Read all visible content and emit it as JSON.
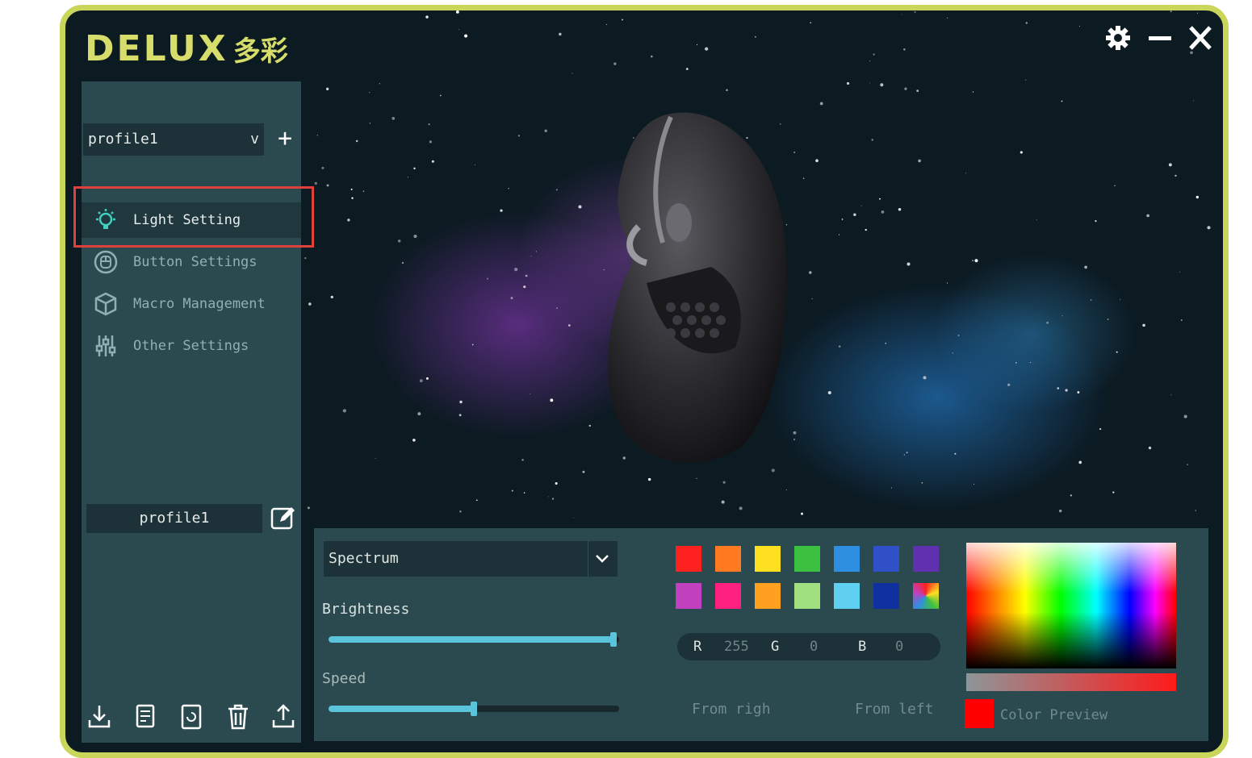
{
  "app": {
    "brand": "DELUX",
    "brand_cjk": "多彩",
    "window_controls": [
      "gear-icon",
      "minimize-icon",
      "close-icon"
    ]
  },
  "sidebar": {
    "profile_select": {
      "value": "profile1",
      "chevron": "v"
    },
    "add_icon": "plus-icon",
    "items": [
      {
        "label": "Light Setting",
        "icon": "bulb-icon",
        "active": true
      },
      {
        "label": "Button Settings",
        "icon": "mouse-circle-icon",
        "active": false
      },
      {
        "label": "Macro Management",
        "icon": "cube-icon",
        "active": false
      },
      {
        "label": "Other Settings",
        "icon": "sliders-icon",
        "active": false
      }
    ],
    "profile_name": "profile1",
    "tools": [
      "import-icon",
      "save-icon",
      "restore-icon",
      "delete-icon",
      "export-icon"
    ]
  },
  "panel": {
    "effect": "Spectrum",
    "brightness_label": "Brightness",
    "brightness_level": 0.98,
    "speed_label": "Speed",
    "speed_level": 0.5,
    "swatches_row1": [
      "#ff2020",
      "#ff7a20",
      "#ffe020",
      "#3cc040",
      "#2e8fe0",
      "#3050c8",
      "#6030b0"
    ],
    "swatches_row2": [
      "#c040c0",
      "#ff2080",
      "#ffa020",
      "#a0e080",
      "#60d0f0",
      "#1030a0",
      "multicolor"
    ],
    "rgb": {
      "r_label": "R",
      "r": "255",
      "g_label": "G",
      "g": "0",
      "b_label": "B",
      "b": "0"
    },
    "direction_right": "From righ",
    "direction_left": "From left",
    "preview_label": "Color Preview",
    "preview_color": "#ff0000"
  }
}
